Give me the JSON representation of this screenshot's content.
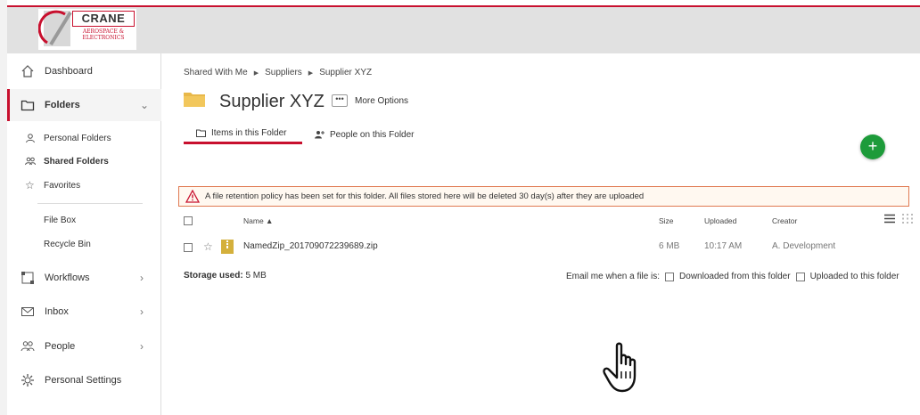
{
  "brand": {
    "name": "CRANE",
    "sub_line1": "AEROSPACE &",
    "sub_line2": "ELECTRONICS",
    "accent_color": "#c8102e"
  },
  "sidebar": {
    "items": [
      {
        "label": "Dashboard",
        "icon": "home-icon"
      },
      {
        "label": "Folders",
        "icon": "folder-icon",
        "active": true
      },
      {
        "label": "Workflows",
        "icon": "workflow-icon"
      },
      {
        "label": "Inbox",
        "icon": "mail-icon"
      },
      {
        "label": "People",
        "icon": "people-icon"
      },
      {
        "label": "Personal Settings",
        "icon": "gear-icon"
      }
    ],
    "sub_items": [
      {
        "label": "Personal Folders",
        "icon": "user-icon"
      },
      {
        "label": "Shared Folders",
        "icon": "shared-users-icon"
      },
      {
        "label": "Favorites",
        "icon": "star-icon"
      },
      {
        "label": "File Box",
        "icon": ""
      },
      {
        "label": "Recycle Bin",
        "icon": ""
      }
    ]
  },
  "breadcrumb": [
    "Shared With Me",
    "Suppliers",
    "Supplier XYZ"
  ],
  "page": {
    "title": "Supplier XYZ",
    "more_options": "More Options"
  },
  "tabs": [
    {
      "label": "Items in this Folder",
      "active": true
    },
    {
      "label": "People on this Folder",
      "active": false
    }
  ],
  "add_button": {
    "label": "+",
    "color": "#1d9b3a"
  },
  "alert": {
    "text": "A file retention policy has been set for this folder. All files stored here will be deleted 30 day(s) after they are uploaded",
    "border_color": "#e07a52"
  },
  "table": {
    "columns": {
      "name": "Name ▲",
      "size": "Size",
      "uploaded": "Uploaded",
      "creator": "Creator"
    },
    "rows": [
      {
        "name": "NamedZip_201709072239689.zip",
        "size": "6 MB",
        "uploaded": "10:17 AM",
        "creator": "A. Development"
      }
    ]
  },
  "footer": {
    "storage_label": "Storage used:",
    "storage_value": "5 MB",
    "email_label": "Email me when a file is:",
    "option_downloaded": "Downloaded from this folder",
    "option_uploaded": "Uploaded to this folder"
  }
}
